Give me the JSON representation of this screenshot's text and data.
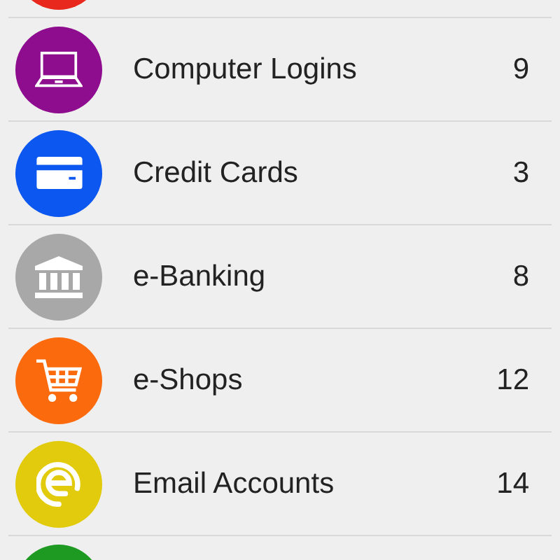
{
  "categories": [
    {
      "kind": "partial",
      "color": "#e8281c"
    },
    {
      "kind": "laptop",
      "color": "#8e0d8e",
      "label": "Computer Logins",
      "count": "9"
    },
    {
      "kind": "card",
      "color": "#0b57f0",
      "label": "Credit Cards",
      "count": "3"
    },
    {
      "kind": "bank",
      "color": "#a8a8a8",
      "label": "e-Banking",
      "count": "8"
    },
    {
      "kind": "cart",
      "color": "#fb6a0c",
      "label": "e-Shops",
      "count": "12"
    },
    {
      "kind": "email",
      "color": "#e2cb0c",
      "label": "Email Accounts",
      "count": "14"
    },
    {
      "kind": "partial",
      "color": "#1e9a22"
    }
  ]
}
